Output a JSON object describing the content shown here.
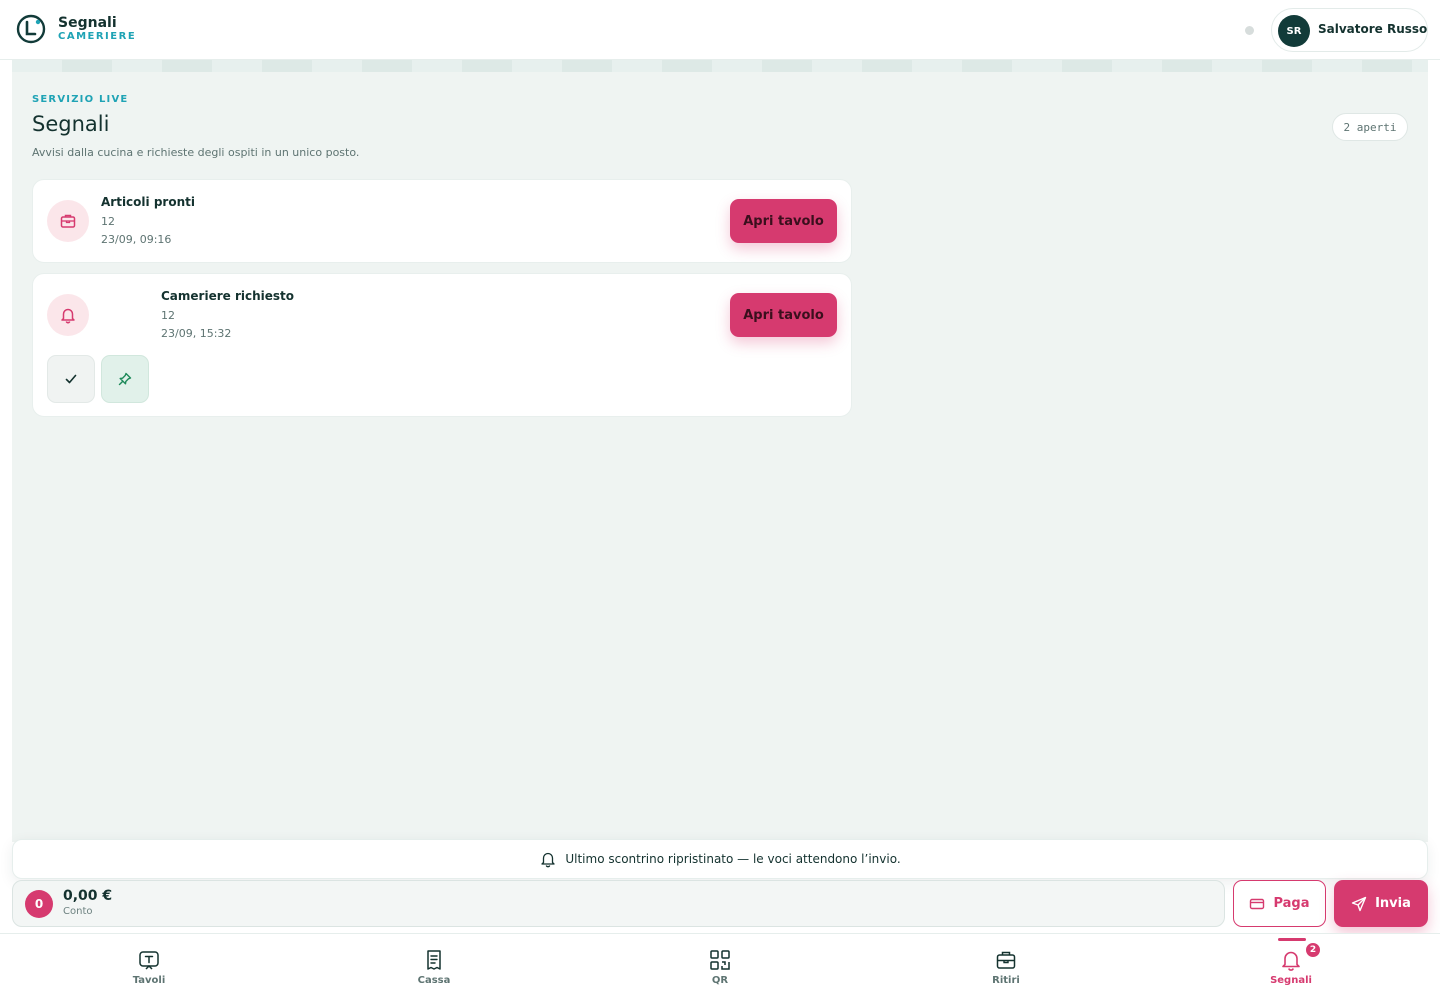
{
  "header": {
    "app_title": "Segnali",
    "app_subtitle": "CAMERIERE",
    "user": {
      "initials": "SR",
      "name": "Salvatore Russo"
    }
  },
  "main": {
    "eyebrow": "SERVIZIO LIVE",
    "title": "Segnali",
    "subtitle": "Avvisi dalla cucina e richieste degli ospiti in un unico posto.",
    "open_count": "2 aperti",
    "signals": [
      {
        "title": "Articoli pronti",
        "table": "12",
        "time": "23/09, 09:16",
        "action": "Apri tavolo",
        "icon": "package-icon"
      },
      {
        "title": "Cameriere richiesto",
        "table": "12",
        "time": "23/09, 15:32",
        "action": "Apri tavolo",
        "icon": "bell-icon"
      }
    ]
  },
  "toast": {
    "text": "Ultimo scontrino ripristinato — le voci attendono l’invio.",
    "icon": "bell-icon"
  },
  "bill": {
    "count": "0",
    "total": "0,00 €",
    "label": "Conto",
    "pay_label": "Paga",
    "send_label": "Invia"
  },
  "nav": {
    "items": [
      {
        "label": "Tavoli",
        "icon": "table-icon"
      },
      {
        "label": "Cassa",
        "icon": "receipt-icon"
      },
      {
        "label": "QR",
        "icon": "qr-icon"
      },
      {
        "label": "Ritiri",
        "icon": "package-icon"
      },
      {
        "label": "Segnali",
        "icon": "bell-icon",
        "badge": "2",
        "active": true
      }
    ]
  },
  "colors": {
    "accent": "#d63a6f",
    "teal": "#1fa3b5",
    "dark": "#123b39",
    "panel": "#eff4f2"
  }
}
